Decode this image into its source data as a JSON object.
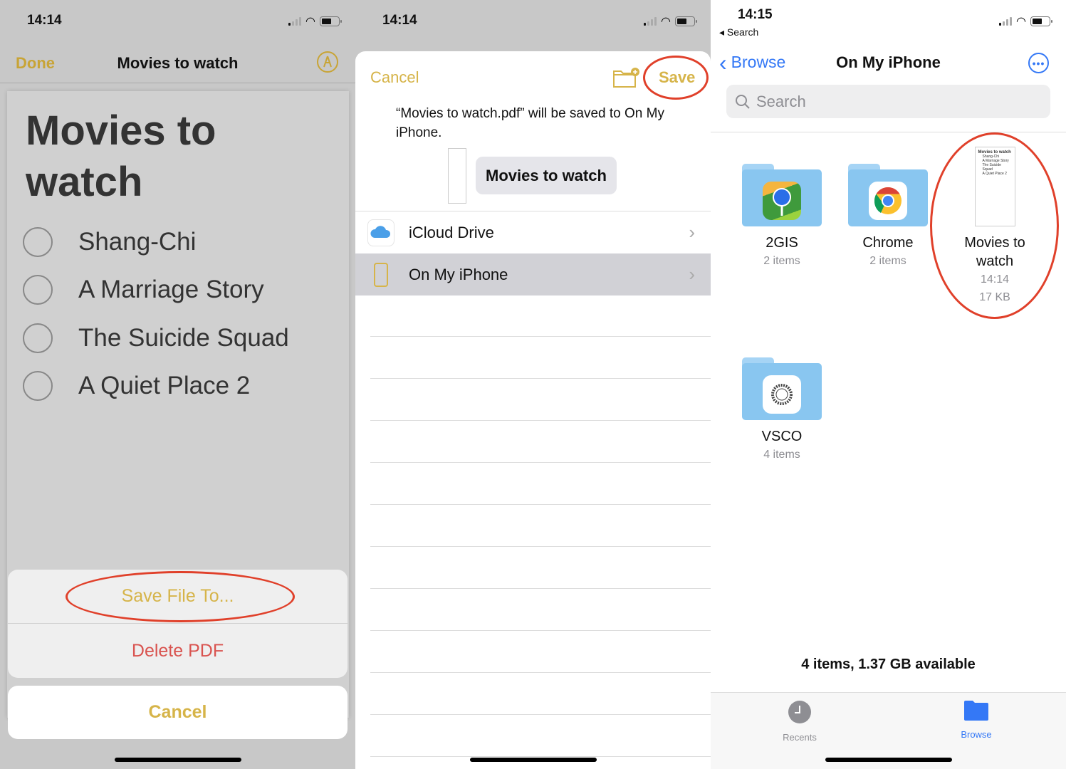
{
  "panel1": {
    "status": {
      "time": "14:14"
    },
    "nav": {
      "done_label": "Done",
      "title": "Movies to watch",
      "markup_icon": "markup-pen-icon"
    },
    "document": {
      "title": "Movies to watch",
      "checklist": [
        "Shang-Chi",
        "A Marriage Story",
        "The Suicide Squad",
        "A Quiet Place 2"
      ]
    },
    "action_sheet": {
      "save_label": "Save File To...",
      "delete_label": "Delete PDF",
      "cancel_label": "Cancel"
    },
    "colors": {
      "accent": "#d6b449",
      "destructive": "#d9534f",
      "highlight": "#e0402a"
    }
  },
  "panel2": {
    "status": {
      "time": "14:14"
    },
    "header": {
      "cancel_label": "Cancel",
      "save_label": "Save",
      "new_folder_icon": "new-folder-icon"
    },
    "message": "“Movies to watch.pdf” will be saved to On My iPhone.",
    "file_name": "Movies to watch",
    "locations": [
      {
        "label": "iCloud Drive",
        "icon": "icloud-icon",
        "selected": false
      },
      {
        "label": "On My iPhone",
        "icon": "iphone-icon",
        "selected": true
      }
    ]
  },
  "panel3": {
    "status": {
      "time": "14:15",
      "back_app": "◂ Search"
    },
    "nav": {
      "back_label": "Browse",
      "title": "On My iPhone",
      "more_icon": "more-icon"
    },
    "search": {
      "placeholder": "Search"
    },
    "items": [
      {
        "name": "2GIS",
        "sub": "2 items",
        "type": "folder",
        "app_icon": "2gis-icon"
      },
      {
        "name": "Chrome",
        "sub": "2 items",
        "type": "folder",
        "app_icon": "chrome-icon"
      },
      {
        "name": "Movies to watch",
        "sub": "14:14",
        "sub2": "17 KB",
        "type": "file"
      },
      {
        "name": "VSCO",
        "sub": "4 items",
        "type": "folder",
        "app_icon": "vsco-icon"
      }
    ],
    "thumb": {
      "title": "Movies to watch",
      "lines": [
        "Shang-Chi",
        "A Marriage Story",
        "The Suicide Squad",
        "A Quiet Place 2"
      ]
    },
    "footer": "4 items, 1.37 GB available",
    "tabs": [
      {
        "label": "Recents",
        "active": false
      },
      {
        "label": "Browse",
        "active": true
      }
    ],
    "colors": {
      "link": "#3478f6",
      "folder": "#89c6f0"
    }
  }
}
